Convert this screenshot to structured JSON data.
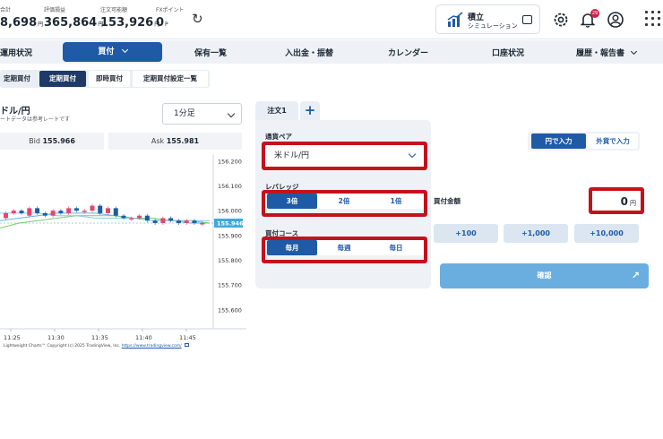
{
  "header": {
    "stats": [
      {
        "label": "合計",
        "value": "8,698",
        "unit": "円"
      },
      {
        "label": "評価損益",
        "value": "365,864",
        "unit": "円"
      },
      {
        "label": "注文可能額",
        "value": "153,926",
        "unit": "円"
      },
      {
        "label": "FXポイント",
        "value": "0",
        "unit": "P"
      }
    ],
    "sim_title": "積立",
    "sim_subtitle": "シミュレーション",
    "notification_count": "29"
  },
  "nav": {
    "items": [
      "運用状況",
      "買付",
      "保有一覧",
      "入出金・振替",
      "カレンダー",
      "口座状況",
      "履歴・報告書"
    ],
    "active_index": 1
  },
  "subtabs": {
    "items": [
      "定期買付",
      "定期買付",
      "即時買付",
      "定期買付設定一覧"
    ],
    "active_index": 1
  },
  "chart_panel": {
    "pair": "ドル/円",
    "note": "ートデータは参考レートです",
    "timeframe": "1分足",
    "bid_label": "Bid",
    "bid_value": "155.966",
    "ask_label": "Ask",
    "ask_value": "155.981",
    "copyright_prefix": "Lightweight Charts™ Copyright (c) 2025 TradingView, Inc.",
    "copyright_link": "https://www.tradingview.com/"
  },
  "chart_data": {
    "type": "line",
    "x_ticks": [
      "11:25",
      "11:30",
      "11:35",
      "11:40",
      "11:45"
    ],
    "y_ticks": [
      "156.200",
      "156.100",
      "156.000",
      "155.900",
      "155.800",
      "155.700",
      "155.600"
    ],
    "ylim": [
      155.56,
      156.21
    ],
    "current_price_label": "155.946",
    "candles": [
      {
        "o": 155.97,
        "c": 155.99
      },
      {
        "o": 155.99,
        "c": 156.0
      },
      {
        "o": 156.0,
        "c": 155.99
      },
      {
        "o": 155.98,
        "c": 156.01
      },
      {
        "o": 156.01,
        "c": 155.99
      },
      {
        "o": 155.99,
        "c": 155.98
      },
      {
        "o": 155.98,
        "c": 156.0
      },
      {
        "o": 156.0,
        "c": 155.99
      },
      {
        "o": 155.99,
        "c": 156.01
      },
      {
        "o": 156.01,
        "c": 156.0
      },
      {
        "o": 156.0,
        "c": 156.0
      },
      {
        "o": 156.0,
        "c": 156.02
      },
      {
        "o": 156.02,
        "c": 155.99
      },
      {
        "o": 155.99,
        "c": 156.01
      },
      {
        "o": 156.01,
        "c": 155.98
      },
      {
        "o": 155.98,
        "c": 155.97
      },
      {
        "o": 155.97,
        "c": 155.97
      },
      {
        "o": 155.97,
        "c": 155.98
      },
      {
        "o": 155.98,
        "c": 155.96
      },
      {
        "o": 155.96,
        "c": 155.95
      },
      {
        "o": 155.95,
        "c": 155.97
      },
      {
        "o": 155.97,
        "c": 155.96
      },
      {
        "o": 155.96,
        "c": 155.95
      },
      {
        "o": 155.95,
        "c": 155.96
      },
      {
        "o": 155.96,
        "c": 155.95
      },
      {
        "o": 155.95,
        "c": 155.95
      }
    ],
    "series": [
      {
        "values": [
          155.96,
          155.97,
          155.98,
          155.99,
          155.99,
          155.99,
          155.98,
          155.97,
          155.96,
          155.96,
          155.95,
          155.95
        ]
      },
      {
        "values": [
          155.93,
          155.95,
          155.96,
          155.97,
          155.98,
          155.98,
          155.98,
          155.97,
          155.97,
          155.96,
          155.96,
          155.95
        ]
      },
      {
        "values": [
          155.99,
          155.99,
          155.99,
          155.98,
          155.98,
          155.97,
          155.97,
          155.97,
          155.96,
          155.96,
          155.96,
          155.96
        ]
      }
    ],
    "colors": {
      "up": "#e8436e",
      "down": "#1f5aa6",
      "line1": "#5fb4e8",
      "line2": "#7acb6a",
      "line3": "#8fc7e8",
      "price_tag": "#3fa9dc"
    }
  },
  "order": {
    "tab_label": "注文1",
    "add_tab": "+",
    "pair_label": "通貨ペア",
    "pair_value": "米ドル/円",
    "leverage_label": "レバレッジ",
    "leverage_options": [
      "3倍",
      "2倍",
      "1倍"
    ],
    "leverage_selected": 0,
    "course_label": "買付コース",
    "course_options": [
      "毎月",
      "毎週",
      "毎日"
    ],
    "course_selected": 0,
    "input_modes": [
      "円で入力",
      "外貨で入力"
    ],
    "input_mode_selected": 0,
    "amount_label": "買付金額",
    "amount_value": "0",
    "amount_unit": "円",
    "quick_adds": [
      "+100",
      "+1,000",
      "+10,000"
    ],
    "confirm_label": "確認",
    "highlight_color": "#c4121d"
  }
}
